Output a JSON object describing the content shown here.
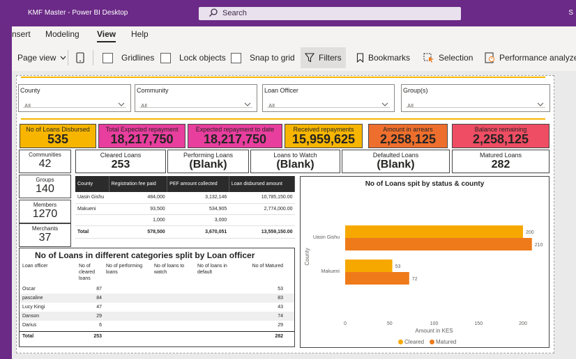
{
  "window": {
    "title": "KMF Master - Power BI Desktop",
    "search_label": "Search",
    "user_initial": "S"
  },
  "ribbon": {
    "tabs": [
      "nsert",
      "Modeling",
      "View",
      "Help"
    ],
    "active_tab": "View",
    "page_view_label": "Page view",
    "gridlines_label": "Gridlines",
    "lock_objects_label": "Lock objects",
    "snap_label": "Snap to grid",
    "filters_label": "Filters",
    "bookmarks_label": "Bookmarks",
    "selection_label": "Selection",
    "perf_label": "Performance analyzer"
  },
  "slicers": [
    {
      "label": "County",
      "value": "All"
    },
    {
      "label": "Community",
      "value": "All"
    },
    {
      "label": "Loan Officer",
      "value": "All"
    },
    {
      "label": "Group(s)",
      "value": "All"
    }
  ],
  "kpis": [
    {
      "label": "No of Loans Disbursed",
      "value": "535",
      "color": "#f7b500"
    },
    {
      "label": "Total Expected repayment",
      "value": "18,217,750",
      "color": "#e83e9e"
    },
    {
      "label": "Expected repayment to date",
      "value": "18,217,750",
      "color": "#e83e9e"
    },
    {
      "label": "Received repayments",
      "value": "15,959,625",
      "color": "#f7b500"
    },
    {
      "label": "Amount in arrears",
      "value": "2,258,125",
      "color": "#ee6f2d"
    },
    {
      "label": "Balance remaining",
      "value": "2,258,125",
      "color": "#ee4d63"
    }
  ],
  "cards": [
    {
      "label": "Cleared Loans",
      "value": "253"
    },
    {
      "label": "Performing Loans",
      "value": "(Blank)"
    },
    {
      "label": "Loans to Watch",
      "value": "(Blank)"
    },
    {
      "label": "Defaulted Loans",
      "value": "(Blank)"
    },
    {
      "label": "Matured Loans",
      "value": "282"
    }
  ],
  "left_cards": [
    {
      "label": "Communities",
      "value": "42"
    },
    {
      "label": "Groups",
      "value": "140"
    },
    {
      "label": "Members",
      "value": "1270"
    },
    {
      "label": "Merchants",
      "value": "37"
    }
  ],
  "county_table": {
    "headers": [
      "County",
      "Registration fee paid",
      "PEF amount collected",
      "Loan disbursed amount"
    ],
    "rows": [
      [
        "Uasin Gishu",
        "484,000",
        "3,132,146",
        "10,785,150.00"
      ],
      [
        "Makueni",
        "93,500",
        "534,905",
        "2,774,000.00"
      ],
      [
        "",
        "1,000",
        "3,000",
        ""
      ]
    ],
    "total": [
      "Total",
      "578,500",
      "3,670,051",
      "13,559,150.00"
    ]
  },
  "officer_table": {
    "title": "No of Loans in different categories split by Loan officer",
    "headers": [
      "Loan officer",
      "No of cleared loans",
      "No of performing loans",
      "No of loans to watch",
      "No of loans in default",
      "No of Matured"
    ],
    "rows": [
      [
        "Oscar",
        "87",
        "",
        "",
        "",
        "53"
      ],
      [
        "pascaline",
        "84",
        "",
        "",
        "",
        "83"
      ],
      [
        "Lucy Kingi",
        "47",
        "",
        "",
        "",
        "43"
      ],
      [
        "Danson",
        "29",
        "",
        "",
        "",
        "74"
      ],
      [
        "Darius",
        "6",
        "",
        "",
        "",
        "29"
      ]
    ],
    "total": [
      "Total",
      "253",
      "",
      "",
      "",
      "282"
    ]
  },
  "chart_data": {
    "type": "bar",
    "orientation": "horizontal",
    "title": "No of Loans spit by status & county",
    "categories": [
      "Uasin Gishu",
      "Makueni"
    ],
    "series": [
      {
        "name": "Cleared",
        "values": [
          200,
          53
        ],
        "color": "#f7a800"
      },
      {
        "name": "Matured",
        "values": [
          210,
          72
        ],
        "color": "#ee7a1a"
      }
    ],
    "xlabel": "Amount in KES",
    "ylabel": "County",
    "xlim": [
      0,
      200
    ],
    "xticks": [
      0,
      50,
      100,
      150,
      200
    ],
    "legend_position": "bottom"
  }
}
